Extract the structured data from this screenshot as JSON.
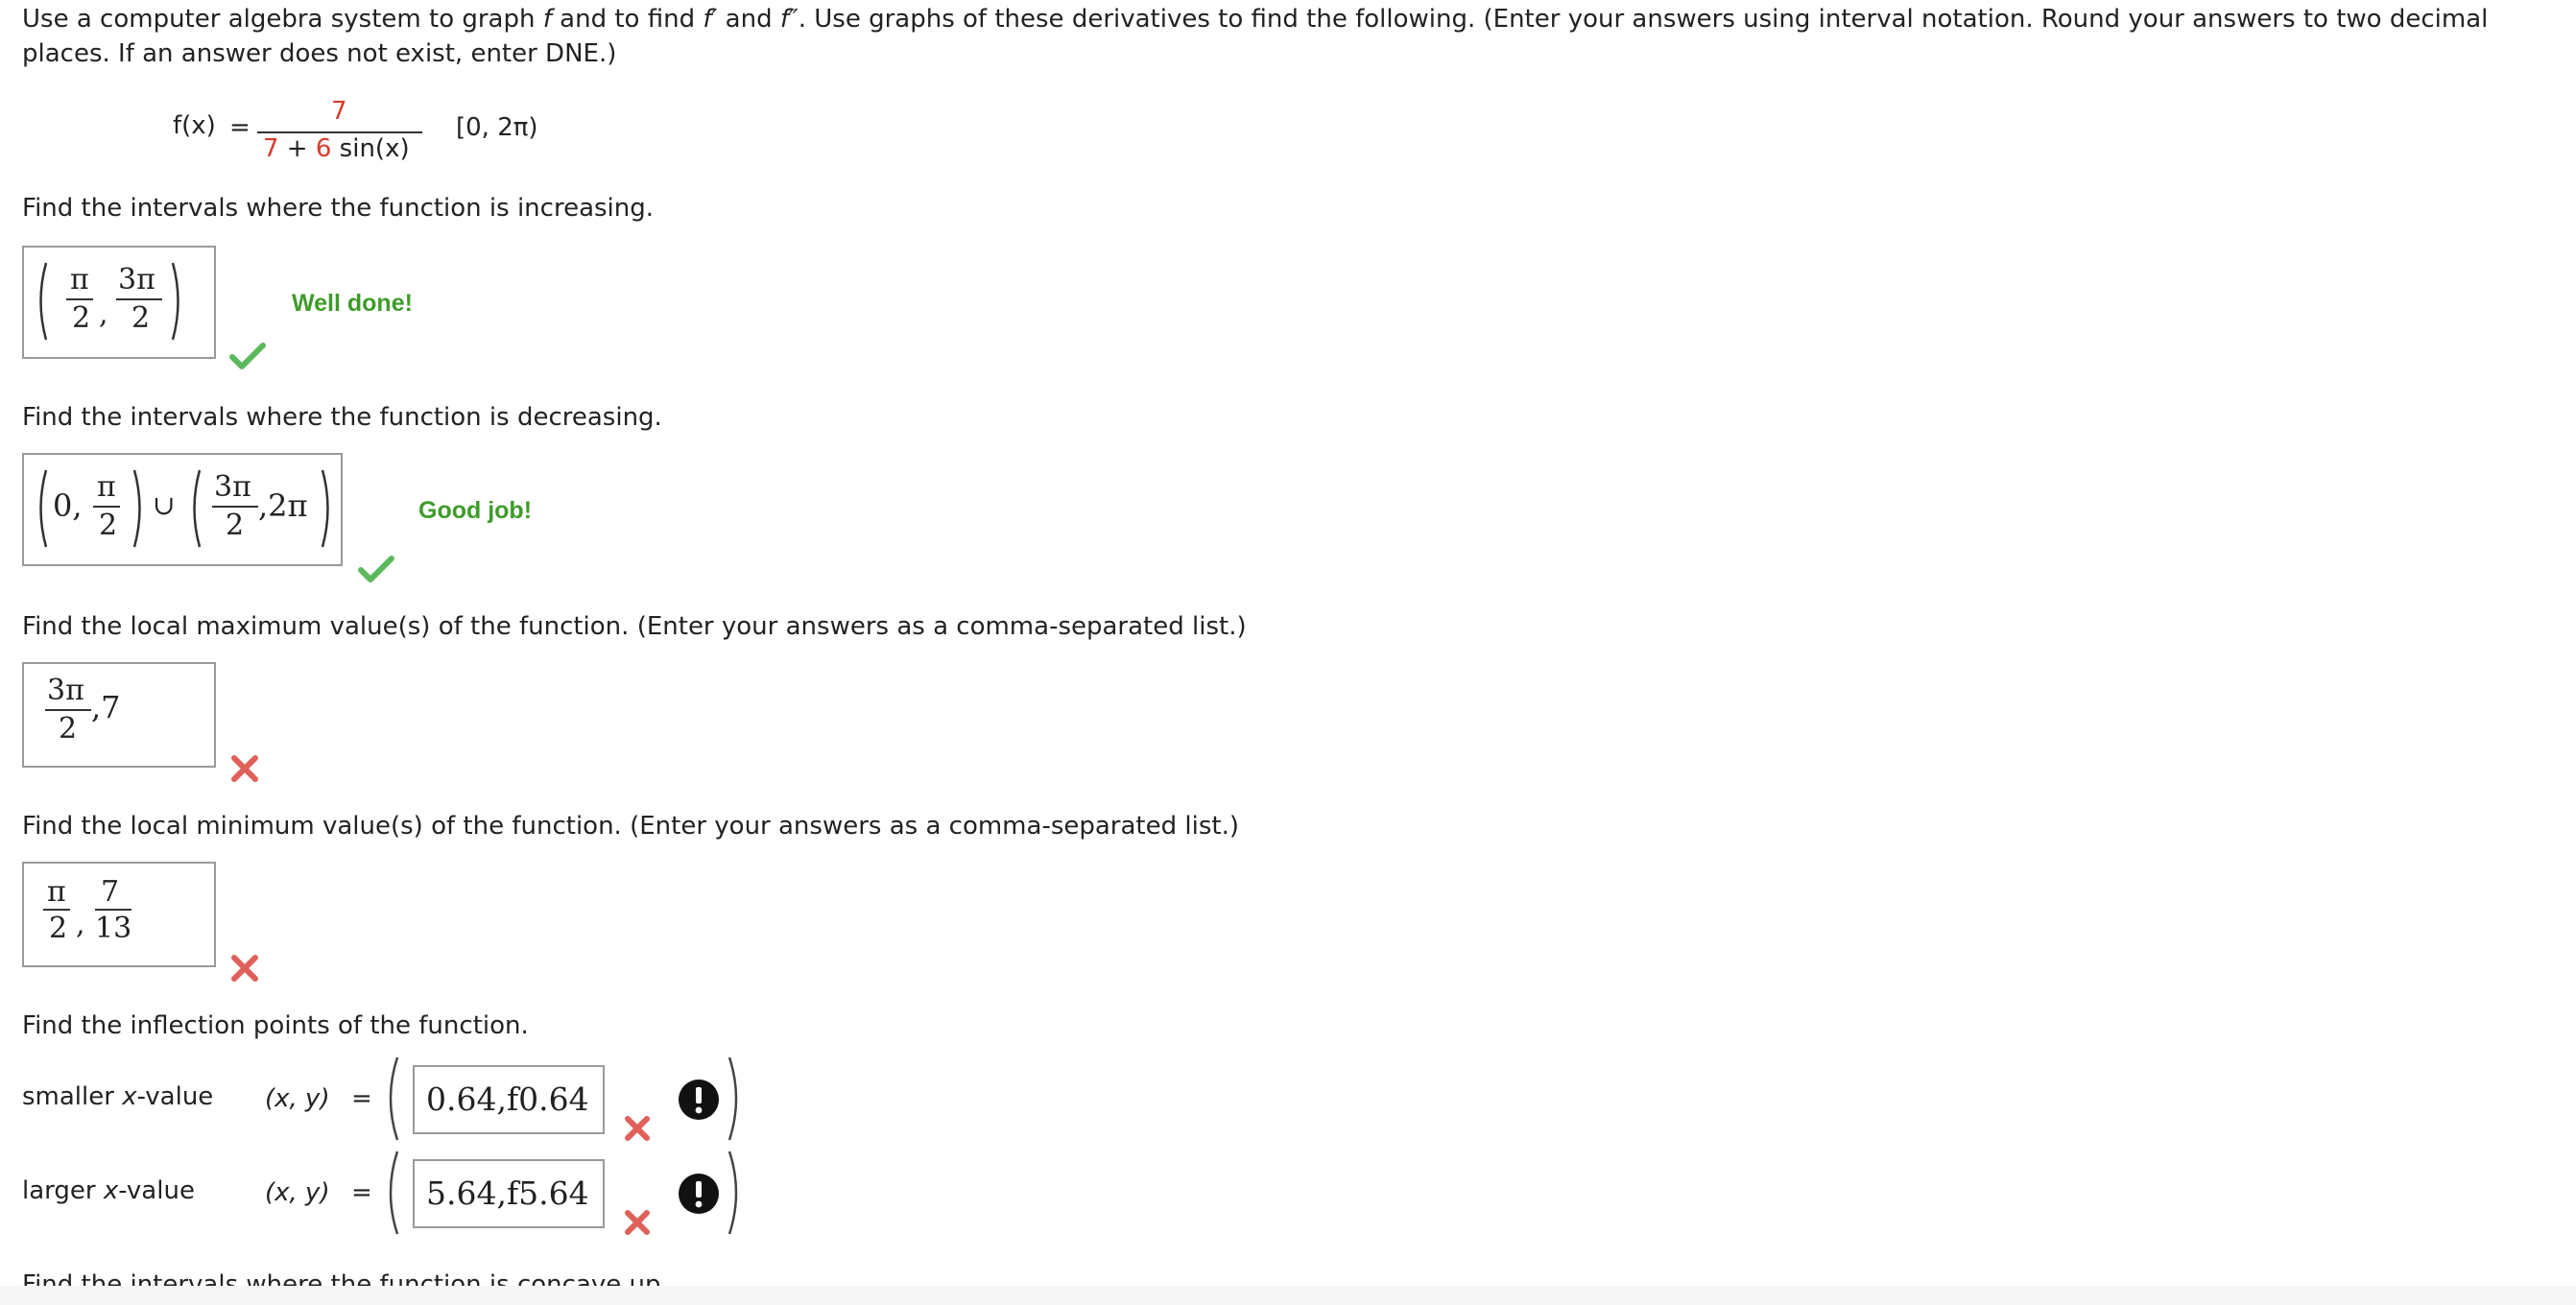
{
  "intro": {
    "p1": "Use a computer algebra system to graph ",
    "f1": "f",
    "p2": " and to find ",
    "f2": "f′",
    "p3": " and ",
    "f3": "f″",
    "p4": ". Use graphs of these derivatives to find the following. (Enter your answers using interval notation. Round your answers to two decimal places. If an answer does not exist, enter DNE.)"
  },
  "function": {
    "lhs": "f(x)",
    "equals": "=",
    "numerator": "7",
    "den_a": "7",
    "den_plus": " + ",
    "den_b": "6",
    "den_c": " sin(x)",
    "interval": "[0, 2π)"
  },
  "q1": {
    "prompt": "Find the intervals where the function is increasing.",
    "feedback": "Well done!",
    "answer": {
      "n1": "π",
      "d1": "2",
      "comma": ",",
      "n2": "3π",
      "d2": "2"
    }
  },
  "q2": {
    "prompt": "Find the intervals where the function is decreasing.",
    "feedback": "Good job!",
    "answer": {
      "zero": "0,",
      "n1": "π",
      "d1": "2",
      "union": "∪",
      "n2": "3π",
      "d2": "2",
      "tail": ",2π"
    }
  },
  "q3": {
    "prompt": "Find the local maximum value(s) of the function. (Enter your answers as a comma-separated list.)",
    "answer": {
      "n1": "3π",
      "d1": "2",
      "tail": ",7"
    }
  },
  "q4": {
    "prompt": "Find the local minimum value(s) of the function. (Enter your answers as a comma-separated list.)",
    "answer": {
      "n1": "π",
      "d1": "2",
      "comma": ",",
      "n2": "7",
      "d2": "13"
    }
  },
  "q5": {
    "prompt": "Find the inflection points of the function.",
    "rows": [
      {
        "label_a": "smaller ",
        "label_x": "x",
        "label_b": "-value",
        "pair": "(x, y)",
        "eq": "=",
        "value": "0.64,f0.64"
      },
      {
        "label_a": "larger ",
        "label_x": "x",
        "label_b": "-value",
        "pair": "(x, y)",
        "eq": "=",
        "value": "5.64,f5.64"
      }
    ]
  },
  "q6": {
    "prompt": "Find the intervals where the function is concave up."
  },
  "colors": {
    "correct": "#5cb85c",
    "incorrect": "#e0605a",
    "feedback": "#3e9c2a",
    "accent_red": "#d83b2d"
  }
}
